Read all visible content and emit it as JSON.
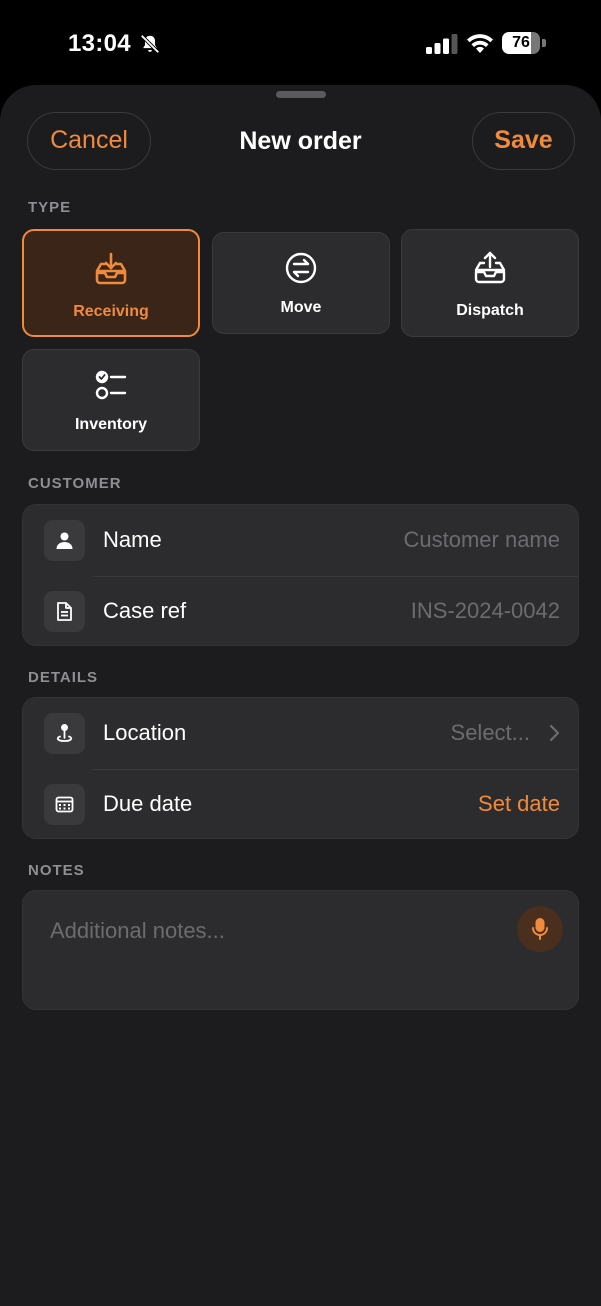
{
  "status_bar": {
    "time": "13:04",
    "battery_level": 76,
    "battery_text": "76",
    "icons": [
      "bell-slash-icon",
      "signal-icon",
      "wifi-icon",
      "battery-icon"
    ]
  },
  "header": {
    "cancel_label": "Cancel",
    "title": "New order",
    "save_label": "Save"
  },
  "type_section": {
    "label": "TYPE",
    "options": [
      {
        "label": "Receiving",
        "icon": "tray-download-icon",
        "selected": true
      },
      {
        "label": "Move",
        "icon": "arrows-exchange-icon",
        "selected": false
      },
      {
        "label": "Dispatch",
        "icon": "tray-upload-icon",
        "selected": false
      },
      {
        "label": "Inventory",
        "icon": "checklist-icon",
        "selected": false
      }
    ]
  },
  "customer_section": {
    "label": "CUSTOMER",
    "rows": [
      {
        "label": "Name",
        "placeholder": "Customer name",
        "icon": "person-icon"
      },
      {
        "label": "Case ref",
        "placeholder": "INS-2024-0042",
        "icon": "document-icon"
      }
    ]
  },
  "details_section": {
    "label": "DETAILS",
    "rows": [
      {
        "label": "Location",
        "value": "Select...",
        "icon": "map-pin-icon"
      },
      {
        "label": "Due date",
        "value": "Set date",
        "icon": "calendar-icon"
      }
    ]
  },
  "notes_section": {
    "label": "NOTES",
    "placeholder": "Additional notes...",
    "icon": "microphone-icon"
  },
  "colors": {
    "accent": "#f08a3c",
    "background": "#1c1c1e",
    "card": "#2c2c2e",
    "muted_text": "#6c6c70"
  }
}
